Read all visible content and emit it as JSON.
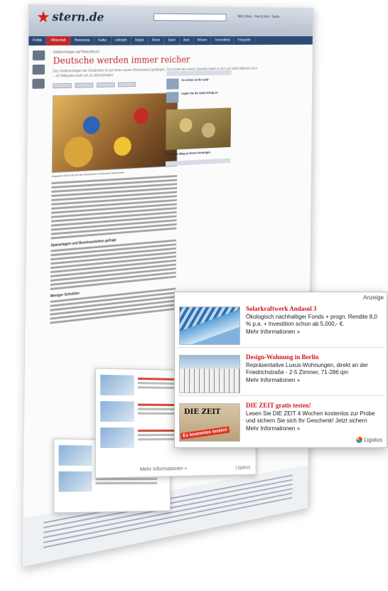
{
  "site": {
    "logo": "stern.de",
    "header_links": "Mein Stern · Hier & Jetzt · Suche"
  },
  "nav": [
    "Politik",
    "Wirtschaft",
    "Panorama",
    "Kultur",
    "Lifestyle",
    "Digital",
    "Reise",
    "Sport",
    "Auto",
    "Wissen",
    "Gesundheit",
    "Fotografie"
  ],
  "article": {
    "kicker": "Geldvermögen auf Rekordhoch",
    "headline": "Deutsche werden immer reicher",
    "teaser": "Das Geldvermögen der Deutschen ist auf einen neuen Höchststand gestiegen. Zum Ende des ersten Quartals belief es sich auf 4,826 Billionen Euro – 42 Milliarden mehr als zu Jahresbeginn.",
    "image_caption": "Dagobert Duck hat bei den Deutschen Konkurrenz bekommen",
    "subhead_1": "Sparanlagen und Bundesanleihen gefragt",
    "subhead_2": "Weniger Schulden"
  },
  "right_column": {
    "item_1_title": "So sicher ist Ihr Geld",
    "item_2_title": "Legen Sie Ihr Geld richtig an",
    "coins_caption": "Der beste Weg zu Ihrem Vermögen"
  },
  "ad": {
    "label": "Anzeige",
    "items": [
      {
        "title": "Solarkraftwerk Andasol 3",
        "desc": "Ökologisch nachhaltiger Fonds + progn. Rendite 8,0 % p.a. + Investition schon ab 5.000,- €.",
        "more": "Mehr Informationen »"
      },
      {
        "title": "Design-Wohnung in Berlin",
        "desc": "Repräsentative Luxus-Wohnungen, direkt an der Friedrichstraße - 2-5 Zimmer, 71-286 qm",
        "more": "Mehr Informationen »"
      },
      {
        "title": "DIE ZEIT gratis testen!",
        "desc": "Lesen Sie DIE ZEIT 4 Wochen kostenlos zur Probe und sichern Sie sich Ihr Geschenk! Jetzt sichern",
        "more": "Mehr Informationen »"
      }
    ],
    "zeit_logo": "DIE ZEIT",
    "zeit_banner": "Ex kostenlos testen!",
    "brand": "Ligatus"
  },
  "back_ad": {
    "more": "Mehr Informationen »",
    "brand": "Ligatus"
  }
}
